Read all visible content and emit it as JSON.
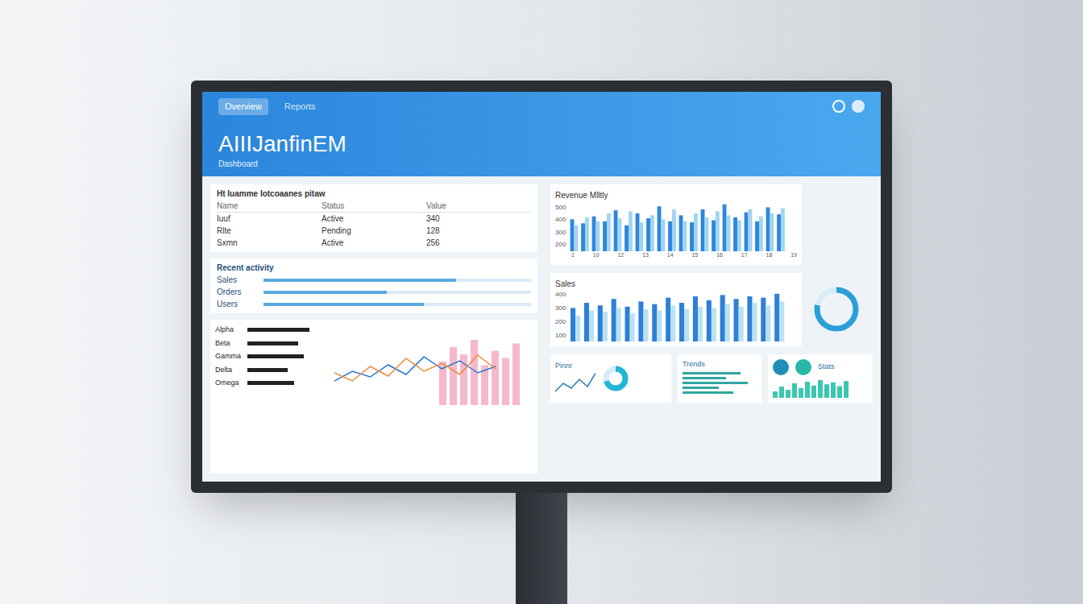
{
  "window": {
    "title": "AIIIJanfinEM",
    "subtitle": "Dashboard"
  },
  "header_tabs": [
    {
      "label": "Overview",
      "selected": true
    },
    {
      "label": "Reports",
      "selected": false
    }
  ],
  "summary_table": {
    "title": "Ht Iuamme Iotcoaanes pitaw",
    "columns": [
      "Name",
      "Status",
      "Value"
    ],
    "rows": [
      [
        "Iuuf",
        "Active",
        "340"
      ],
      [
        "Rlte",
        "Pending",
        "128"
      ],
      [
        "Sxmn",
        "Active",
        "256"
      ]
    ]
  },
  "metrics": {
    "title": "Recent activity",
    "rows": [
      {
        "label": "Sales",
        "level": 0.72
      },
      {
        "label": "Orders",
        "level": 0.46
      },
      {
        "label": "Users",
        "level": 0.6
      }
    ]
  },
  "trend_chart": {
    "min": 0,
    "max": 100,
    "list": [
      {
        "label": "Alpha",
        "level": 0.85
      },
      {
        "label": "Beta",
        "level": 0.7
      },
      {
        "label": "Gamma",
        "level": 0.78
      },
      {
        "label": "Delta",
        "level": 0.55
      },
      {
        "label": "Omega",
        "level": 0.64
      }
    ],
    "series": [
      {
        "name": "A",
        "color": "#1f77d0",
        "values": [
          30,
          42,
          35,
          50,
          38,
          60,
          45,
          55,
          40,
          48
        ]
      },
      {
        "name": "B",
        "color": "#f08a3c",
        "values": [
          40,
          30,
          48,
          36,
          58,
          42,
          52,
          38,
          62,
          45
        ]
      }
    ],
    "bars": [
      60,
      80,
      70,
      90,
      55,
      75,
      65,
      85
    ]
  },
  "revenue_chart": {
    "title": "Revenue Mlltly",
    "min": 0,
    "max": 500,
    "ticks": [
      "500",
      "400",
      "300",
      "200"
    ],
    "x_labels": [
      "1",
      "10",
      "12",
      "13",
      "14",
      "15",
      "16",
      "17",
      "18",
      "19"
    ],
    "series": [
      {
        "name": "Current",
        "color": "#2f86dc",
        "values": [
          320,
          280,
          350,
          300,
          410,
          260,
          380,
          330,
          450,
          300,
          360,
          290,
          420,
          310,
          470,
          340,
          390,
          300,
          440,
          370
        ]
      },
      {
        "name": "Previous",
        "color": "#9fd6f2",
        "values": [
          260,
          340,
          300,
          380,
          330,
          400,
          290,
          360,
          320,
          420,
          300,
          380,
          340,
          400,
          360,
          310,
          420,
          350,
          380,
          430
        ]
      }
    ]
  },
  "sales_chart": {
    "title": "Sales",
    "min": 0,
    "max": 400,
    "ticks": [
      "400",
      "300",
      "200",
      "100"
    ],
    "series": [
      {
        "name": "Current",
        "color": "#2f7fd6",
        "values": [
          260,
          300,
          280,
          330,
          270,
          310,
          290,
          340,
          300,
          350,
          320,
          360,
          330,
          350,
          340,
          370
        ]
      },
      {
        "name": "Previous",
        "color": "#b8e2f5",
        "values": [
          200,
          240,
          230,
          260,
          220,
          250,
          240,
          280,
          250,
          270,
          260,
          290,
          270,
          300,
          280,
          310
        ]
      }
    ]
  },
  "donut": {
    "level": 0.78,
    "color": "#2a9fd8"
  },
  "cards": [
    {
      "title": "Pinnr",
      "level": 0.7,
      "values": [
        10,
        30,
        18,
        40,
        22,
        55
      ]
    },
    {
      "title": "Trends",
      "rows": [
        0.8,
        0.6,
        0.9,
        0.5,
        0.7
      ]
    },
    {
      "title": "Stats",
      "values": [
        20,
        35,
        25,
        45,
        30,
        50,
        38,
        55,
        42,
        48,
        36,
        52
      ]
    }
  ]
}
